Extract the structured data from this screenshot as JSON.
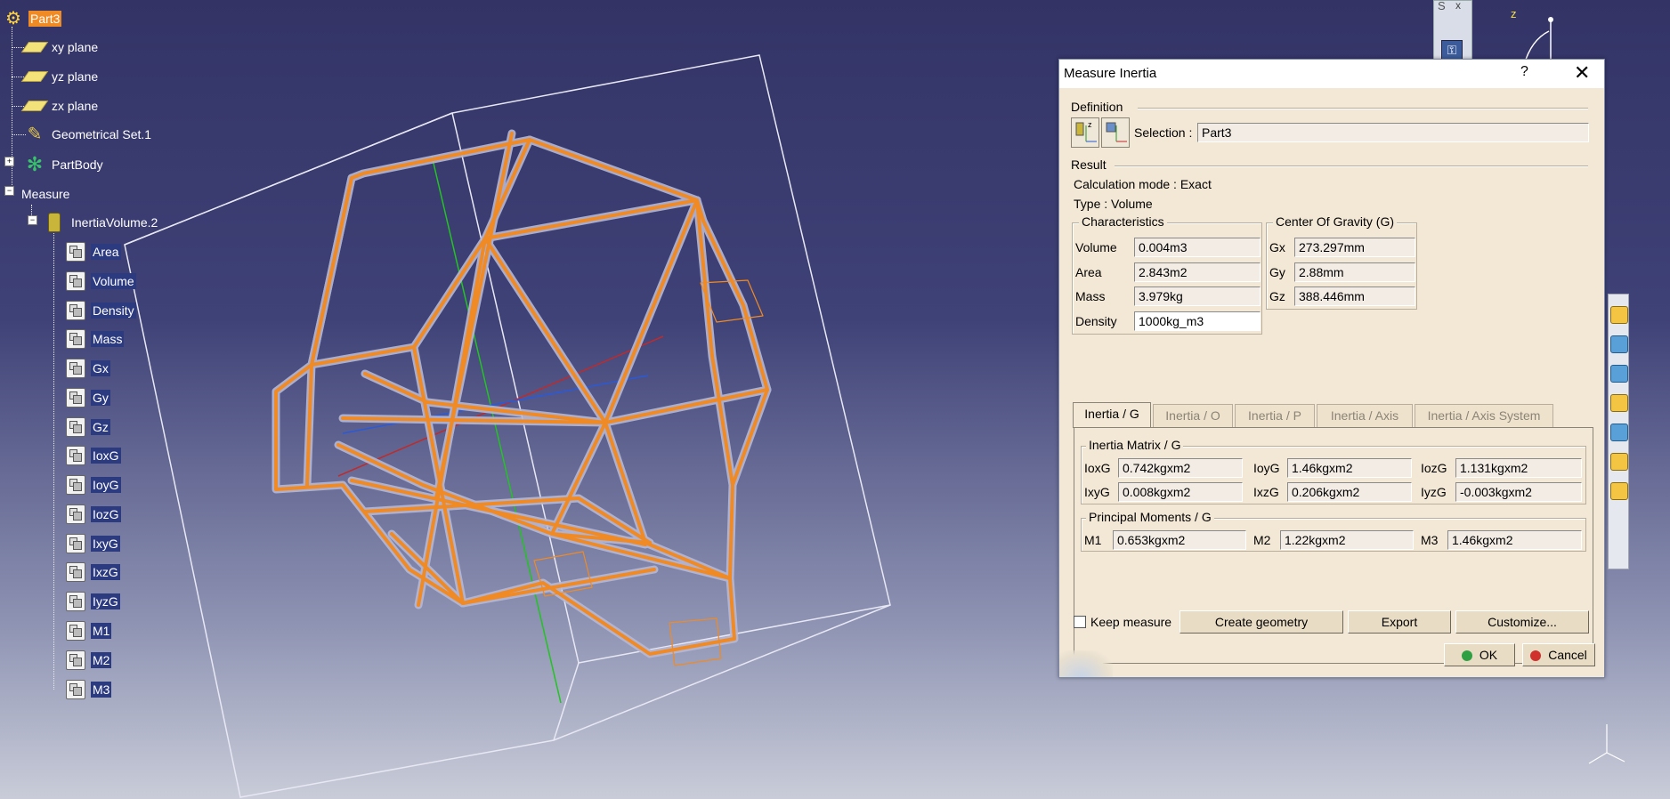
{
  "tree": {
    "root": "Part3",
    "items": [
      {
        "label": "xy plane",
        "icon": "plane-icon"
      },
      {
        "label": "yz plane",
        "icon": "plane-icon"
      },
      {
        "label": "zx plane",
        "icon": "plane-icon"
      },
      {
        "label": "Geometrical Set.1",
        "icon": "geometrical-set-icon"
      },
      {
        "label": "PartBody",
        "icon": "part-body-icon"
      },
      {
        "label": "Measure",
        "icon": "none"
      },
      {
        "label": "InertiaVolume.2",
        "icon": "inertia-volume-icon"
      }
    ],
    "params": [
      "Area",
      "Volume",
      "Density",
      "Mass",
      "Gx",
      "Gy",
      "Gz",
      "IoxG",
      "IoyG",
      "IozG",
      "IxyG",
      "IxzG",
      "IyzG",
      "M1",
      "M2",
      "M3"
    ]
  },
  "toolbar_top": {
    "label": "S",
    "close": "x"
  },
  "compass": {
    "z_label": "z"
  },
  "dialog": {
    "title": "Measure Inertia",
    "help": "?",
    "close": "✕",
    "definition_label": "Definition",
    "selection_label": "Selection :",
    "selection_value": "Part3",
    "result_label": "Result",
    "calc_mode": "Calculation mode :  Exact",
    "type": "Type :  Volume",
    "characteristics": {
      "title": "Characteristics",
      "volume_label": "Volume",
      "volume": "0.004m3",
      "area_label": "Area",
      "area": "2.843m2",
      "mass_label": "Mass",
      "mass": "3.979kg",
      "density_label": "Density",
      "density": "1000kg_m3"
    },
    "cog": {
      "title": "Center Of Gravity (G)",
      "gx_label": "Gx",
      "gx": "273.297mm",
      "gy_label": "Gy",
      "gy": "2.88mm",
      "gz_label": "Gz",
      "gz": "388.446mm"
    },
    "tabs": [
      "Inertia / G",
      "Inertia / O",
      "Inertia / P",
      "Inertia / Axis",
      "Inertia / Axis System"
    ],
    "matrix": {
      "title": "Inertia Matrix / G",
      "ioxg_label": "IoxG",
      "ioxg": "0.742kgxm2",
      "ioyg_label": "IoyG",
      "ioyg": "1.46kgxm2",
      "iozg_label": "IozG",
      "iozg": "1.131kgxm2",
      "ixyg_label": "IxyG",
      "ixyg": "0.008kgxm2",
      "ixzg_label": "IxzG",
      "ixzg": "0.206kgxm2",
      "iyzg_label": "IyzG",
      "iyzg": "-0.003kgxm2"
    },
    "principal": {
      "title": "Principal Moments / G",
      "m1_label": "M1",
      "m1": "0.653kgxm2",
      "m2_label": "M2",
      "m2": "1.22kgxm2",
      "m3_label": "M3",
      "m3": "1.46kgxm2"
    },
    "keep_measure": "Keep measure",
    "create_geometry": "Create geometry",
    "export": "Export",
    "customize": "Customize...",
    "ok": "OK",
    "cancel": "Cancel"
  },
  "colors": {
    "selection": "#f08a24",
    "frame": "#f08a24",
    "background_top": "#333366",
    "ok_led": "#2ea043",
    "cancel_led": "#d0312d"
  }
}
